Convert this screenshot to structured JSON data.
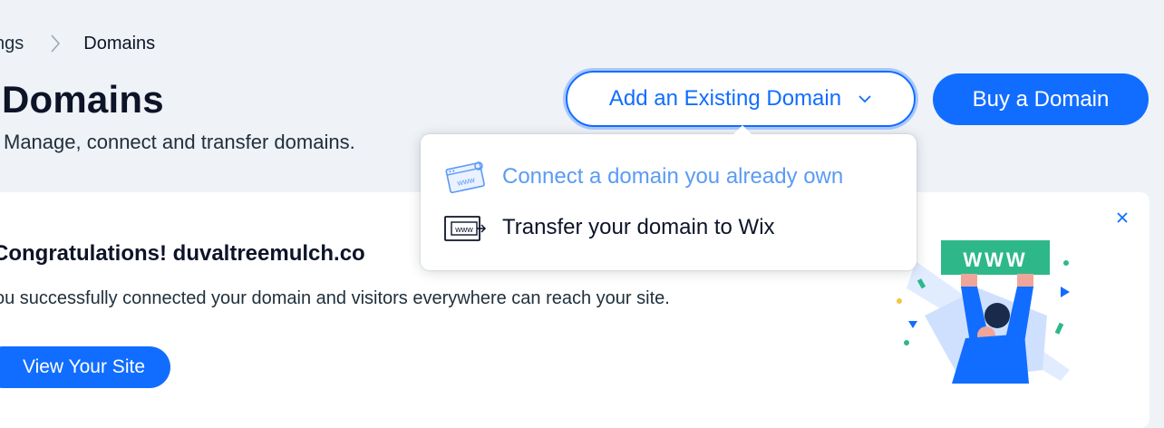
{
  "breadcrumb": {
    "previous": "ngs",
    "current": "Domains"
  },
  "header": {
    "title": "Domains",
    "subtitle": "Manage, connect and transfer domains."
  },
  "actions": {
    "add_existing": "Add an Existing Domain",
    "buy": "Buy a Domain"
  },
  "dropdown": {
    "items": [
      {
        "label": "Connect a domain you already own",
        "icon": "www-window-connect-icon"
      },
      {
        "label": "Transfer your domain to Wix",
        "icon": "www-transfer-icon"
      }
    ]
  },
  "notice": {
    "title": "Congratulations! duvaltreemulch.co",
    "text": "ou successfully connected your domain and visitors everywhere can reach your site.",
    "button": "View Your Site",
    "illustration_text": "WWW"
  },
  "colors": {
    "accent": "#116dff",
    "background": "#eff2f6",
    "illustration_green": "#2eb88a"
  }
}
